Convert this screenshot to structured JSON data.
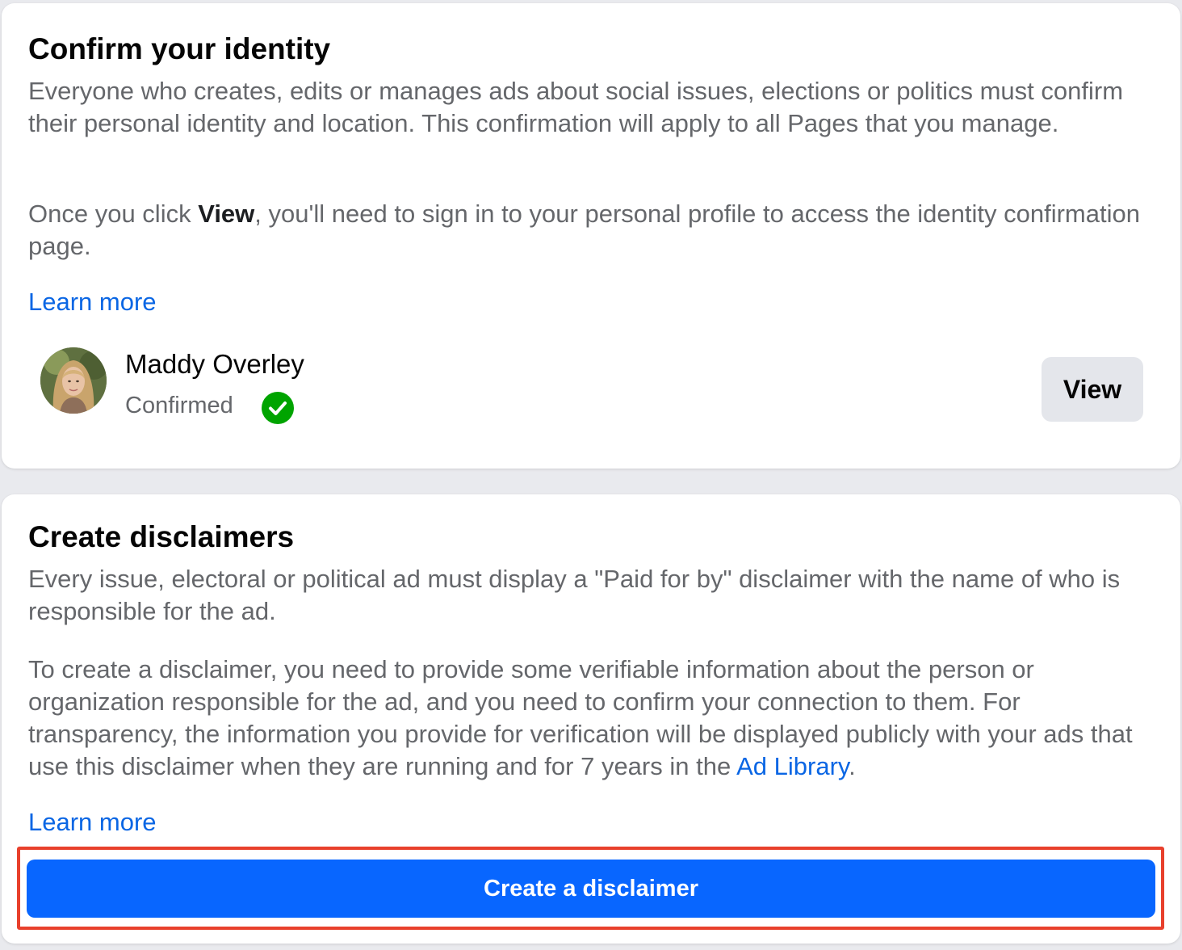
{
  "identity": {
    "title": "Confirm your identity",
    "paragraph1": "Everyone who creates, edits or manages ads about social issues, elections or politics must confirm their personal identity and location. This confirmation will apply to all Pages that you manage.",
    "paragraph2_prefix": "Once you click ",
    "paragraph2_bold": "View",
    "paragraph2_suffix": ", you'll need to sign in to your personal profile to access the identity confirmation page.",
    "learn_more": "Learn more",
    "profile": {
      "name": "Maddy Overley",
      "status": "Confirmed",
      "status_icon": "check-circle-icon",
      "status_color": "#00a400"
    },
    "view_button": "View"
  },
  "disclaimers": {
    "title": "Create disclaimers",
    "paragraph1": "Every issue, electoral or political ad must display a \"Paid for by\" disclaimer with the name of who is responsible for the ad.",
    "paragraph2_prefix": "To create a disclaimer, you need to provide some verifiable information about the person or organization responsible for the ad, and you need to confirm your connection to them. For transparency, the information you provide for verification will be displayed publicly with your ads that use this disclaimer when they are running and for 7 years in the ",
    "paragraph2_link": "Ad Library",
    "paragraph2_suffix": ".",
    "learn_more": "Learn more",
    "create_button": "Create a disclaimer",
    "highlight_color": "#e8402c"
  },
  "colors": {
    "primary": "#0866ff",
    "link": "#0a66e4",
    "secondary_button": "#e4e6eb",
    "text_secondary": "#65676b"
  }
}
